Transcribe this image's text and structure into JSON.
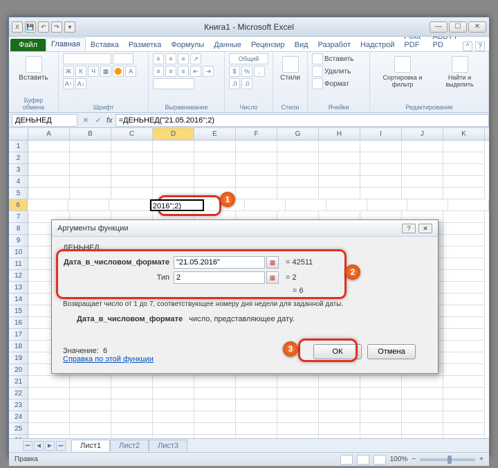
{
  "title": "Книга1  -  Microsoft Excel",
  "tabs": {
    "file": "Файл",
    "items": [
      "Главная",
      "Вставка",
      "Разметка",
      "Формулы",
      "Данные",
      "Рецензир",
      "Вид",
      "Разработ",
      "Надстрой",
      "Foxit PDF",
      "ABBYY PD"
    ],
    "active_index": 0
  },
  "ribbon": {
    "paste": "Вставить",
    "clipboard": "Буфер обмена",
    "font": "Шрифт",
    "alignment": "Выравнивание",
    "number": "Число",
    "number_format": "Общий",
    "styles": "Стили",
    "styles_btn": "Стили",
    "cells": "Ячейки",
    "insert": "Вставить",
    "delete": "Удалить",
    "format": "Формат",
    "editing": "Редактирование",
    "sort": "Сортировка и фильтр",
    "find": "Найти и выделить"
  },
  "formula_bar": {
    "name_box": "ДЕНЬНЕД",
    "formula": "=ДЕНЬНЕД(\"21.05.2016\";2)"
  },
  "columns": [
    "A",
    "B",
    "C",
    "D",
    "E",
    "F",
    "G",
    "H",
    "I",
    "J",
    "K"
  ],
  "active_col": "D",
  "active_row": 6,
  "cell_display": "2016\";2)",
  "dialog": {
    "title": "Аргументы функции",
    "func_name": "ДЕНЬНЕД",
    "arg1_label": "Дата_в_числовом_формате",
    "arg1_value": "\"21.05.2016\"",
    "arg1_result": "=   42511",
    "arg2_label": "Тип",
    "arg2_value": "2",
    "arg2_result": "=   2",
    "func_result": "=   6",
    "description": "Возвращает число от 1 до 7, соответствующее номеру дня недели для заданной даты.",
    "arg_desc_label": "Дата_в_числовом_формате",
    "arg_desc": "число, представляющее дату.",
    "value_label": "Значение:",
    "value": "6",
    "help_link": "Справка по этой функции",
    "ok": "ОК",
    "cancel": "Отмена"
  },
  "sheets": [
    "Лист1",
    "Лист2",
    "Лист3"
  ],
  "status": {
    "mode": "Правка",
    "zoom": "100%"
  },
  "callouts": {
    "c1": "1",
    "c2": "2",
    "c3": "3"
  },
  "chart_data": null
}
